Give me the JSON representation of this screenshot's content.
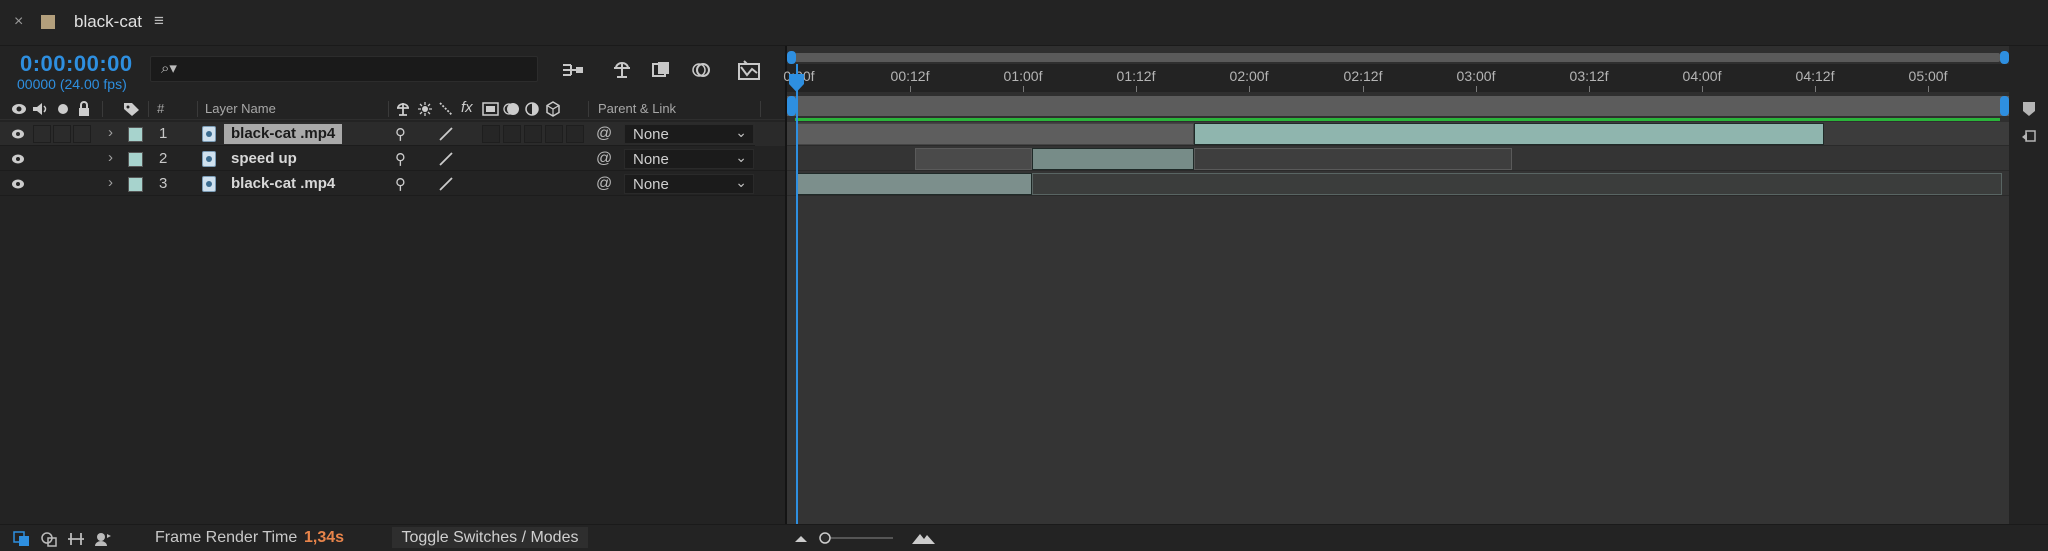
{
  "tab": {
    "close": "×",
    "title": "black-cat",
    "menu": "≡",
    "swatch_color": "#b39f7c"
  },
  "header": {
    "timecode": "0:00:00:00",
    "fps": "00000 (24.00 fps)",
    "search_placeholder": ""
  },
  "columns": {
    "hash": "#",
    "layer_name": "Layer Name",
    "parent_link": "Parent & Link",
    "fx": "fx"
  },
  "layers": [
    {
      "num": "1",
      "name": "black-cat .mp4",
      "parent": "None",
      "selected": true
    },
    {
      "num": "2",
      "name": "speed up",
      "parent": "None",
      "selected": false
    },
    {
      "num": "3",
      "name": "black-cat .mp4",
      "parent": "None",
      "selected": false
    }
  ],
  "ruler": {
    "labels": [
      "0:00f",
      "00:12f",
      "01:00f",
      "01:12f",
      "02:00f",
      "02:12f",
      "03:00f",
      "03:12f",
      "04:00f",
      "04:12f",
      "05:00f"
    ]
  },
  "footer": {
    "frame_render_label": "Frame Render Time",
    "frame_render_value": "1,34s",
    "toggle_label": "Toggle Switches / Modes"
  },
  "colors": {
    "accent": "#2e8fe0",
    "label_swatch": "#a7d3cd",
    "green_bar": "#2ab43a",
    "render_value": "#e8844a",
    "clip_fill": "#8fb5ae"
  }
}
